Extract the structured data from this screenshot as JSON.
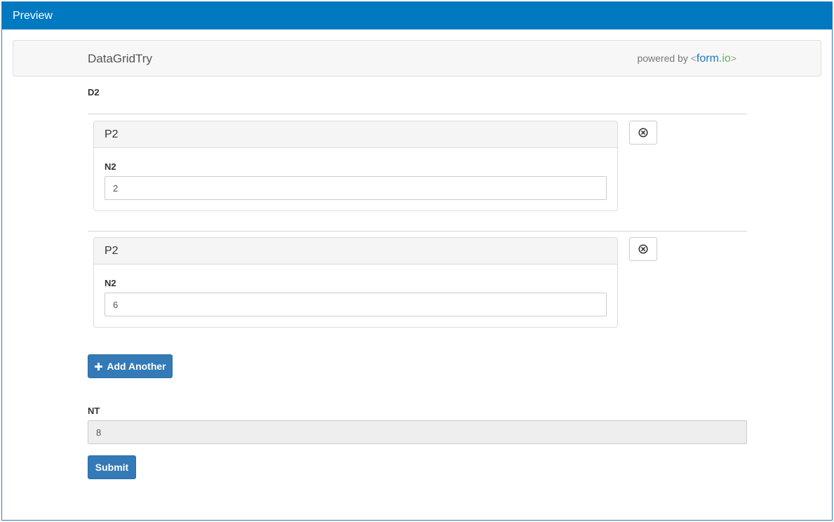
{
  "window": {
    "title": "Preview"
  },
  "header": {
    "form_title": "DataGridTry",
    "powered_prefix": "powered by ",
    "brand_open": "<",
    "brand_form": "form",
    "brand_io": ".io",
    "brand_close": ">"
  },
  "datagrid": {
    "label": "D2",
    "rows": [
      {
        "panel_title": "P2",
        "field_label": "N2",
        "value": "2"
      },
      {
        "panel_title": "P2",
        "field_label": "N2",
        "value": "6"
      }
    ],
    "remove_icon": "close-circle-icon",
    "add_icon": "plus-icon",
    "add_label": "Add Another"
  },
  "total": {
    "label": "NT",
    "value": "8"
  },
  "submit_label": "Submit",
  "colors": {
    "titlebar": "#0079c1",
    "primary_button": "#337ab7",
    "brand_form": "#1f7cc2",
    "brand_io": "#5cb85c"
  }
}
